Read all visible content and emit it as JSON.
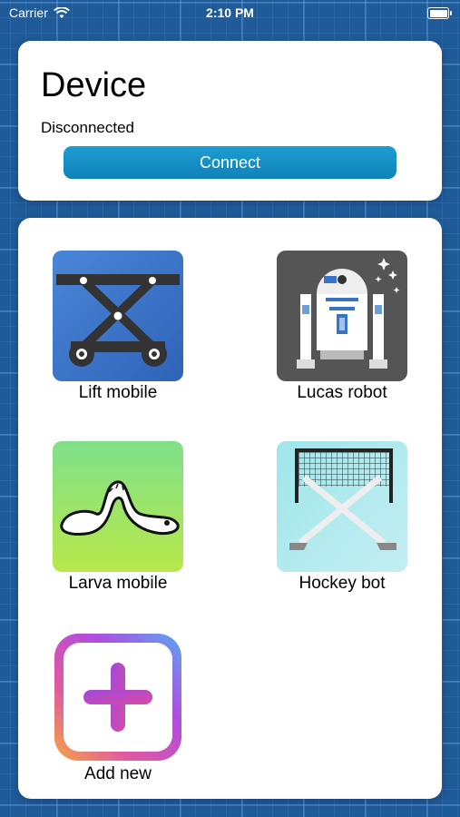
{
  "status_bar": {
    "carrier": "Carrier",
    "time": "2:10 PM"
  },
  "device": {
    "title": "Device",
    "status": "Disconnected",
    "connect_label": "Connect"
  },
  "projects": [
    {
      "label": "Lift mobile",
      "icon": "scissor-lift-icon"
    },
    {
      "label": "Lucas robot",
      "icon": "droid-robot-icon"
    },
    {
      "label": "Larva mobile",
      "icon": "larva-icon"
    },
    {
      "label": "Hockey bot",
      "icon": "hockey-goal-icon"
    },
    {
      "label": "Add new",
      "icon": "plus-icon"
    }
  ],
  "colors": {
    "connect_button": "#1592c4",
    "background": "#1f5a99"
  }
}
